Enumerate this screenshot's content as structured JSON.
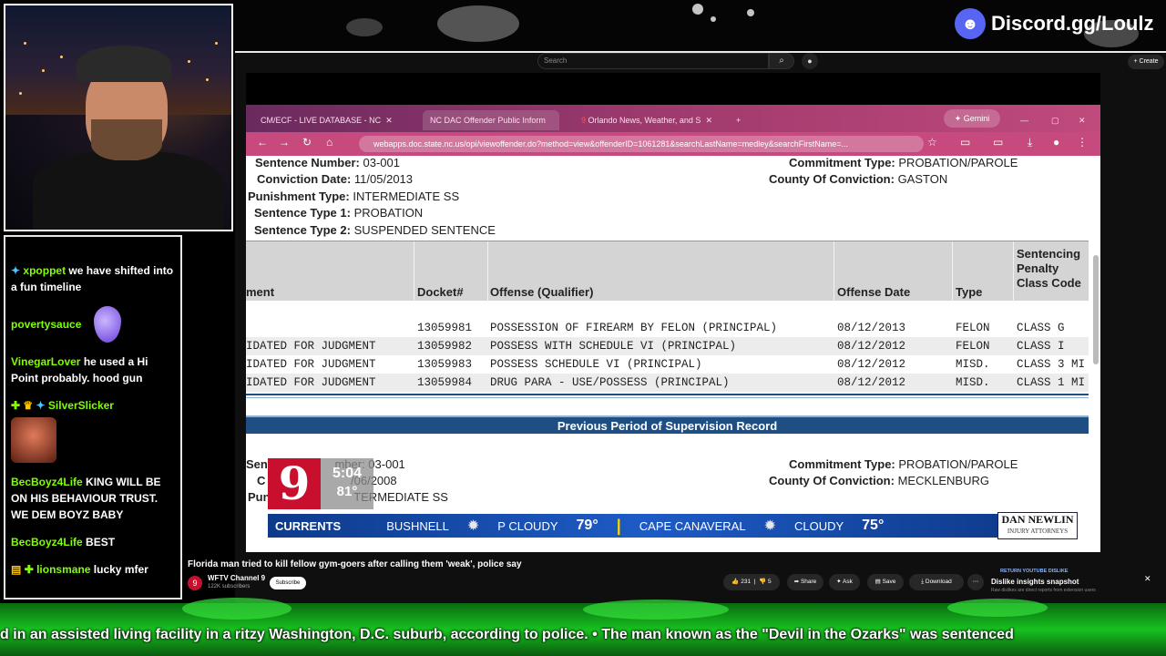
{
  "discord": {
    "text": "Discord.gg/Loulz"
  },
  "chat": [
    {
      "user": "xpoppet",
      "text": "we have shifted into a fun timeline"
    },
    {
      "user": "povertysauce",
      "text": ""
    },
    {
      "user": "VinegarLover",
      "text": "he used a Hi Point probably. hood gun"
    },
    {
      "user": "SilverSlicker",
      "text": ""
    },
    {
      "user": "BecBoyz4Life",
      "text": "KING WILL BE ON HIS BEHAVIOUR TRUST. WE DEM BOYZ BABY"
    },
    {
      "user": "BecBoyz4Life",
      "text": "BEST"
    },
    {
      "user": "lionsmane",
      "text": "lucky mfer"
    }
  ],
  "youtube": {
    "search_placeholder": "Search",
    "create_label": "Create",
    "video_title": "Florida man tried to kill fellow gym-goers after calling them 'weak', police say",
    "channel_name": "WFTV Channel 9",
    "channel_subs": "122K subscribers",
    "subscribe_label": "Subscribe",
    "likes": "231",
    "dislikes": "5",
    "share_label": "Share",
    "ask_label": "Ask",
    "save_label": "Save",
    "download_label": "Download",
    "ext_badge": "RETURN YOUTUBE DISLIKE",
    "ext_title": "Dislike insights snapshot",
    "ext_sub": "Raw dislikes are direct reports from extension users"
  },
  "browser": {
    "tabs": [
      "CM/ECF - LIVE DATABASE - NC",
      "NC DAC Offender Public Inform",
      "Orlando News, Weather, and S"
    ],
    "gemini_label": "Gemini",
    "url": "webapps.doc.state.nc.us/opi/viewoffender.do?method=view&offenderID=1061281&searchLastName=medley&searchFirstName=..."
  },
  "record": {
    "sentence_number_label": "Sentence Number:",
    "sentence_number": "03-001",
    "conviction_date_label": "Conviction Date:",
    "conviction_date": "11/05/2013",
    "punishment_type_label": "Punishment Type:",
    "punishment_type": "INTERMEDIATE SS",
    "sentence_type1_label": "Sentence Type 1:",
    "sentence_type1": "PROBATION",
    "sentence_type2_label": "Sentence Type 2:",
    "sentence_type2": "SUSPENDED SENTENCE",
    "commitment_type_label": "Commitment Type:",
    "commitment_type": "PROBATION/PAROLE",
    "county_label": "County Of Conviction:",
    "county": "GASTON"
  },
  "table": {
    "headers": [
      "ment",
      "Docket#",
      "Offense (Qualifier)",
      "Offense Date",
      "Type",
      "Sentencing Penalty Class Code"
    ],
    "rows": [
      [
        "",
        "13059981",
        "POSSESSION OF FIREARM BY FELON (PRINCIPAL)",
        "08/12/2013",
        "FELON",
        "CLASS G"
      ],
      [
        "IDATED FOR JUDGMENT",
        "13059982",
        "POSSESS WITH SCHEDULE VI (PRINCIPAL)",
        "08/12/2012",
        "FELON",
        "CLASS I"
      ],
      [
        "IDATED FOR JUDGMENT",
        "13059983",
        "POSSESS SCHEDULE VI (PRINCIPAL)",
        "08/12/2012",
        "MISD.",
        "CLASS 3 MI"
      ],
      [
        "IDATED FOR JUDGMENT",
        "13059984",
        "DRUG PARA - USE/POSSESS (PRINCIPAL)",
        "08/12/2012",
        "MISD.",
        "CLASS 1 MI"
      ]
    ]
  },
  "previous": {
    "bar_title": "Previous Period of Supervision Record",
    "sentence_partial": "Sen",
    "sentence_number_partial": "mber: 03-001",
    "conv_partial": "C",
    "conv_date_partial": "/06/2008",
    "pun_partial": "Pun",
    "pun_value_partial": "TERMEDIATE SS",
    "commitment_type_label": "Commitment Type:",
    "commitment_type": "PROBATION/PAROLE",
    "county_label": "County Of Conviction:",
    "county": "MECKLENBURG"
  },
  "news": {
    "logo": "9",
    "time": "5:04",
    "temp": "81°",
    "ticker_label": "CURRENTS",
    "loc1": "BUSHNELL",
    "cond1": "P CLOUDY",
    "temp1": "79°",
    "loc2": "CAPE CANAVERAL",
    "cond2": "CLOUDY",
    "temp2": "75°",
    "sponsor1": "DAN NEWLIN",
    "sponsor2": "INJURY ATTORNEYS"
  },
  "bottom_ticker": "d in an assisted living facility in a ritzy Washington, D.C. suburb, according to police.      •      The man known as the \"Devil in the Ozarks\" was sentenced"
}
